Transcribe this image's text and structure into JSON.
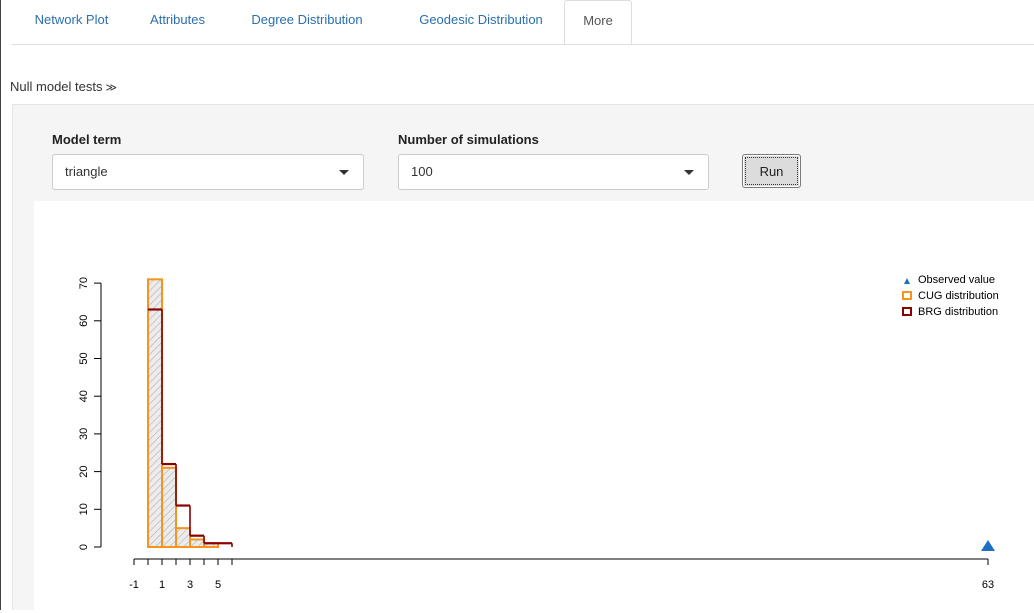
{
  "tabs": [
    {
      "label": "Network Plot",
      "active": false
    },
    {
      "label": "Attributes",
      "active": false
    },
    {
      "label": "Degree Distribution",
      "active": false
    },
    {
      "label": "Geodesic Distribution",
      "active": false
    },
    {
      "label": "More",
      "active": true
    }
  ],
  "section": {
    "title": "Null model tests",
    "toggle_glyph": "≫"
  },
  "controls": {
    "model_term_label": "Model term",
    "model_term_value": "triangle",
    "num_sims_label": "Number of simulations",
    "num_sims_value": "100",
    "run_label": "Run"
  },
  "colors": {
    "cug": "#f7941d",
    "brg": "#8b0000",
    "observed": "#1f6fbf",
    "hatch": "#b0b0b0"
  },
  "chart_data": {
    "type": "histogram",
    "title": "",
    "xlabel": "",
    "ylabel": "",
    "ylim": [
      0,
      70
    ],
    "yticks": [
      0,
      10,
      20,
      30,
      40,
      50,
      60,
      70
    ],
    "xticks_labeled": [
      "-1",
      "1",
      "3",
      "5",
      "63"
    ],
    "bins": [
      {
        "x0": 0,
        "x1": 1,
        "cug": 71,
        "brg": 63
      },
      {
        "x0": 1,
        "x1": 2,
        "cug": 21,
        "brg": 22
      },
      {
        "x0": 2,
        "x1": 3,
        "cug": 5,
        "brg": 11
      },
      {
        "x0": 3,
        "x1": 4,
        "cug": 2,
        "brg": 3
      },
      {
        "x0": 4,
        "x1": 5,
        "cug": 1,
        "brg": 1
      },
      {
        "x0": 5,
        "x1": 6,
        "cug": 0,
        "brg": 1
      }
    ],
    "observed_value": 63,
    "legend": {
      "position": "top-right",
      "entries": [
        "Observed value",
        "CUG distribution",
        "BRG distribution"
      ]
    }
  }
}
